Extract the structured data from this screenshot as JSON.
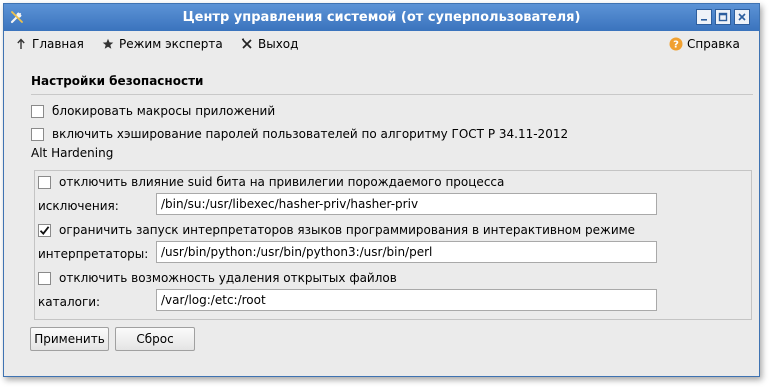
{
  "window": {
    "title": "Центр управления системой (от суперпользователя)"
  },
  "toolbar": {
    "home_label": "Главная",
    "expert_label": "Режим эксперта",
    "exit_label": "Выход",
    "help_label": "Справка"
  },
  "security": {
    "section_title": "Настройки безопасности",
    "block_macros": {
      "label": "блокировать макросы приложений",
      "checked": false
    },
    "hash_passwords": {
      "label": "включить хэширование паролей пользователей по алгоритму ГОСТ Р 34.11-2012",
      "checked": false
    }
  },
  "hardening": {
    "title": "Alt Hardening",
    "suid": {
      "label": "отключить влияние suid бита на привилегии порождаемого процесса",
      "checked": false
    },
    "exceptions_label": "исключения:",
    "exceptions_value": "/bin/su:/usr/libexec/hasher-priv/hasher-priv",
    "interpreters": {
      "label": "ограничить запуск интерпретаторов языков программирования в интерактивном режиме",
      "checked": true
    },
    "interpreters_label": "интерпретаторы:",
    "interpreters_value": "/usr/bin/python:/usr/bin/python3:/usr/bin/perl",
    "delete_open": {
      "label": "отключить возможность удаления открытых файлов",
      "checked": false
    },
    "catalogs_label": "каталоги:",
    "catalogs_value": "/var/log:/etc:/root"
  },
  "actions": {
    "apply_label": "Применить",
    "reset_label": "Сброс"
  },
  "colors": {
    "titlebar": "#3a73bd",
    "help_icon": "#f0a030"
  }
}
